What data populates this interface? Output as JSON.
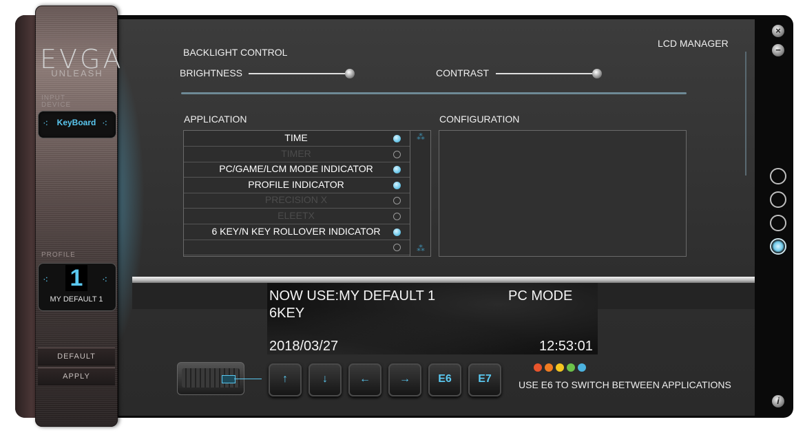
{
  "brand": {
    "logo": "EVGA",
    "tagline": "UNLEASH"
  },
  "sidebar": {
    "input_device_label": "INPUT DEVICE",
    "device_value": "KeyBoard",
    "profile_label": "PROFILE",
    "profile_number": "1",
    "profile_name": "MY DEFAULT 1",
    "default_button": "DEFAULT",
    "apply_button": "APPLY"
  },
  "header": {
    "lcd_manager": "LCD MANAGER"
  },
  "backlight": {
    "title": "BACKLIGHT CONTROL",
    "brightness_label": "BRIGHTNESS",
    "brightness_level": 1.0,
    "contrast_label": "CONTRAST",
    "contrast_level": 1.0
  },
  "application": {
    "title": "APPLICATION",
    "items": [
      {
        "label": "TIME",
        "enabled": true
      },
      {
        "label": "TIMER",
        "enabled": false
      },
      {
        "label": "PC/GAME/LCM MODE INDICATOR",
        "enabled": true
      },
      {
        "label": "PROFILE INDICATOR",
        "enabled": true
      },
      {
        "label": "PRECISION X",
        "enabled": false
      },
      {
        "label": "ELEETX",
        "enabled": false
      },
      {
        "label": "6 KEY/N KEY ROLLOVER INDICATOR",
        "enabled": true
      },
      {
        "label": "",
        "enabled": false
      }
    ]
  },
  "configuration": {
    "title": "CONFIGURATION"
  },
  "lcd": {
    "now_use": "NOW USE:MY DEFAULT 1",
    "mode": "PC MODE",
    "rollover": "6KEY",
    "date": "2018/03/27",
    "time": "12:53:01"
  },
  "keys": {
    "up": "↑",
    "down": "↓",
    "left": "←",
    "right": "→",
    "e6": "E6",
    "e7": "E7"
  },
  "app_dots": [
    "#e8542c",
    "#f07c22",
    "#f5c520",
    "#6cc24a",
    "#4cb3e0"
  ],
  "hint": "USE E6 TO SWITCH BETWEEN APPLICATIONS",
  "colors": {
    "accent": "#5ac8f0",
    "background": "#333333"
  }
}
